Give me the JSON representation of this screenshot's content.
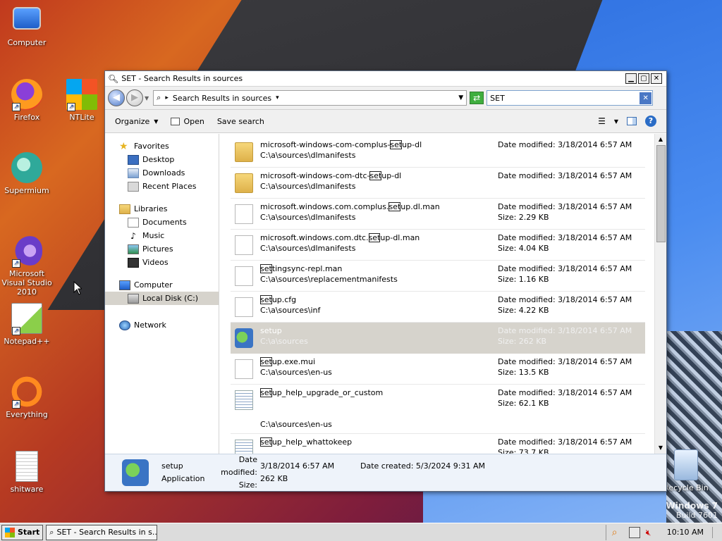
{
  "desktop": {
    "icons": [
      {
        "label": "Computer",
        "icon": "computer-icon"
      },
      {
        "label": "Firefox",
        "icon": "firefox-icon"
      },
      {
        "label": "NTLite",
        "icon": "ntlite-icon"
      },
      {
        "label": "Supermium",
        "icon": "supermium-icon"
      },
      {
        "label": "Microsoft Visual Studio 2010",
        "icon": "visual-studio-icon"
      },
      {
        "label": "Notepad++",
        "icon": "notepadpp-icon"
      },
      {
        "label": "Everything",
        "icon": "everything-icon"
      },
      {
        "label": "shitware",
        "icon": "text-file-icon"
      },
      {
        "label": "Recycle Bin",
        "icon": "recycle-bin-icon"
      }
    ],
    "watermark": {
      "line1": "Windows 7",
      "line2": "Build 7601"
    }
  },
  "window": {
    "title": "SET - Search Results in sources",
    "address": {
      "text": "Search Results in sources"
    },
    "search": {
      "value": "SET"
    },
    "toolbar": {
      "organize": "Organize",
      "open": "Open",
      "save_search": "Save search"
    }
  },
  "nav": {
    "favorites": "Favorites",
    "desktop": "Desktop",
    "downloads": "Downloads",
    "recent": "Recent Places",
    "libraries": "Libraries",
    "documents": "Documents",
    "music": "Music",
    "pictures": "Pictures",
    "videos": "Videos",
    "computer": "Computer",
    "local_disk": "Local Disk (C:)",
    "network": "Network"
  },
  "results": [
    {
      "pre": "microsoft-windows-com-complus-",
      "hl": "set",
      "post": "up-dl",
      "path": "C:\\a\\sources\\dlmanifests",
      "modified": "Date modified: 3/18/2014 6:57 AM",
      "size": "",
      "icon": "folder-icon"
    },
    {
      "pre": "microsoft-windows-com-dtc-",
      "hl": "set",
      "post": "up-dl",
      "path": "C:\\a\\sources\\dlmanifests",
      "modified": "Date modified: 3/18/2014 6:57 AM",
      "size": "",
      "icon": "folder-icon"
    },
    {
      "pre": "microsoft.windows.com.complus.",
      "hl": "set",
      "post": "up.dl.man",
      "path": "C:\\a\\sources\\dlmanifests",
      "modified": "Date modified: 3/18/2014 6:57 AM",
      "size": "Size: 2.29 KB",
      "icon": "file-icon"
    },
    {
      "pre": "microsoft.windows.com.dtc.",
      "hl": "set",
      "post": "up-dl.man",
      "path": "C:\\a\\sources\\dlmanifests",
      "modified": "Date modified: 3/18/2014 6:57 AM",
      "size": "Size: 4.04 KB",
      "icon": "file-icon"
    },
    {
      "pre": "",
      "hl": "set",
      "post": "tingsync-repl.man",
      "path": "C:\\a\\sources\\replacementmanifests",
      "modified": "Date modified: 3/18/2014 6:57 AM",
      "size": "Size: 1.16 KB",
      "icon": "file-icon"
    },
    {
      "pre": "",
      "hl": "set",
      "post": "up.cfg",
      "path": "C:\\a\\sources\\inf",
      "modified": "Date modified: 3/18/2014 6:57 AM",
      "size": "Size: 4.22 KB",
      "icon": "file-icon"
    },
    {
      "pre": "",
      "hl": "",
      "post": "setup",
      "path": "C:\\a\\sources",
      "modified": "Date modified: 3/18/2014 6:57 AM",
      "size": "Size: 262 KB",
      "icon": "setup-exe-icon"
    },
    {
      "pre": "",
      "hl": "set",
      "post": "up.exe.mui",
      "path": "C:\\a\\sources\\en-us",
      "modified": "Date modified: 3/18/2014 6:57 AM",
      "size": "Size: 13.5 KB",
      "icon": "file-icon"
    },
    {
      "pre": "",
      "hl": "set",
      "post": "up_help_upgrade_or_custom",
      "path": "C:\\a\\sources\\en-us",
      "modified": "Date modified: 3/18/2014 6:57 AM",
      "size": "Size: 62.1 KB",
      "icon": "text-file-icon"
    },
    {
      "pre": "",
      "hl": "set",
      "post": "up_help_whattokeep",
      "path": "",
      "modified": "Date modified: 3/18/2014 6:57 AM",
      "size": "Size: 73.7 KB",
      "icon": "text-file-icon"
    }
  ],
  "details": {
    "name": "setup",
    "type": "Application",
    "modified_label": "Date modified:",
    "modified_value": "3/18/2014 6:57 AM",
    "size_label": "Size:",
    "size_value": "262 KB",
    "created_label": "Date created:",
    "created_value": "5/3/2024 9:31 AM"
  },
  "taskbar": {
    "start": "Start",
    "task": "SET - Search Results in s...",
    "clock": "10:10 AM"
  }
}
